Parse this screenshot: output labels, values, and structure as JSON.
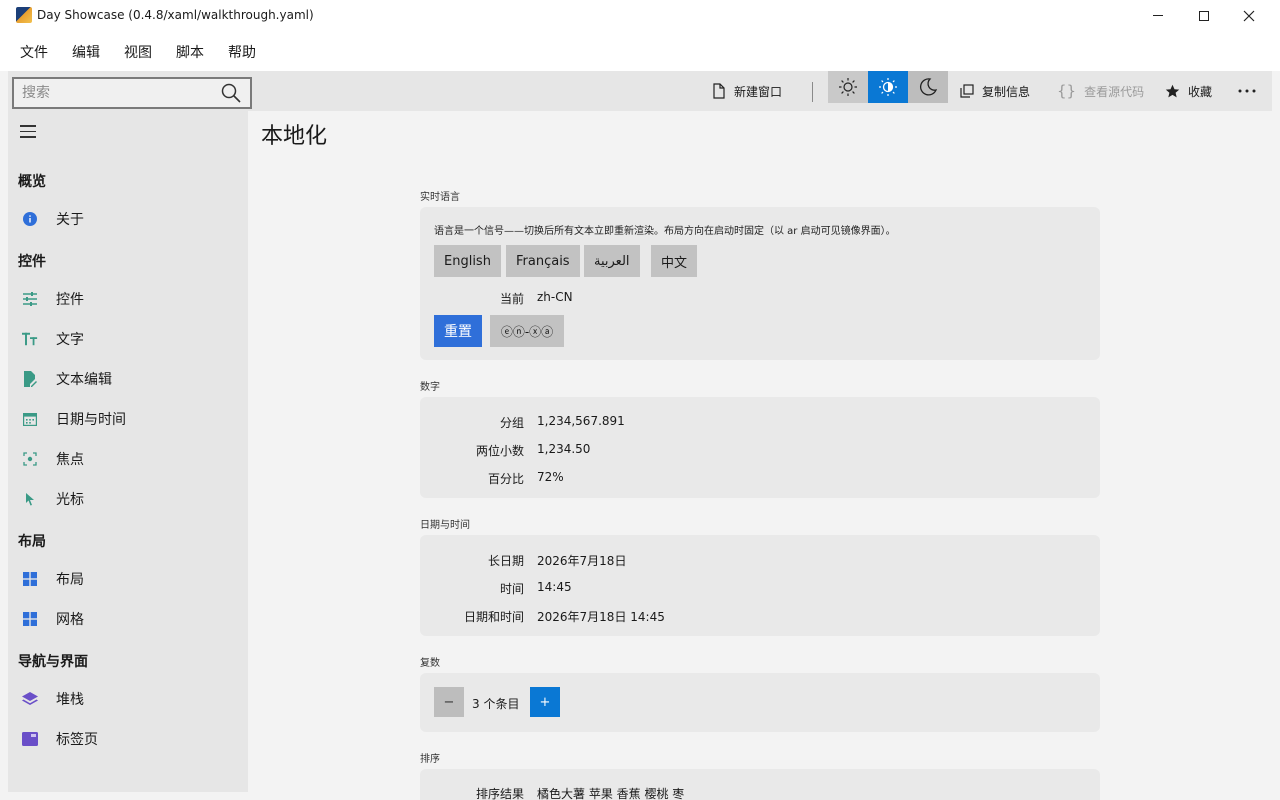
{
  "window": {
    "title": "Day Showcase (0.4.8/xaml/walkthrough.yaml)"
  },
  "menu": [
    "文件",
    "编辑",
    "视图",
    "脚本",
    "帮助"
  ],
  "toolbar": {
    "search_placeholder": "搜索",
    "new_window": "新建窗口",
    "copy_info": "复制信息",
    "view_source": "查看源代码",
    "favorite": "收藏",
    "active_theme": "auto"
  },
  "sidebar": {
    "sections": [
      {
        "title": "概览",
        "items": [
          {
            "label": "关于",
            "icon": "info-icon"
          }
        ]
      },
      {
        "title": "控件",
        "items": [
          {
            "label": "控件",
            "icon": "sliders-icon"
          },
          {
            "label": "文字",
            "icon": "text-size-icon"
          },
          {
            "label": "文本编辑",
            "icon": "edit-document-icon"
          },
          {
            "label": "日期与时间",
            "icon": "calendar-icon"
          },
          {
            "label": "焦点",
            "icon": "focus-icon"
          },
          {
            "label": "光标",
            "icon": "cursor-icon"
          }
        ]
      },
      {
        "title": "布局",
        "items": [
          {
            "label": "布局",
            "icon": "layout-grid-icon"
          },
          {
            "label": "网格",
            "icon": "grid-icon"
          }
        ]
      },
      {
        "title": "导航与界面",
        "items": [
          {
            "label": "堆栈",
            "icon": "stack-icon"
          },
          {
            "label": "标签页",
            "icon": "tabs-icon"
          }
        ]
      }
    ]
  },
  "page": {
    "title": "本地化",
    "live_lang": {
      "label": "实时语言",
      "note": "语言是一个信号——切换后所有文本立即重新渲染。布局方向在启动时固定（以 ar 启动可见镜像界面）。",
      "buttons": [
        "English",
        "Français",
        "العربية",
        "中文"
      ],
      "current_key": "当前",
      "current_value": "zh-CN",
      "reset": "重置",
      "pseudo": "ⓔⓝ-ⓧⓐ"
    },
    "numbers": {
      "label": "数字",
      "rows": [
        {
          "k": "分组",
          "v": "1,234,567.891"
        },
        {
          "k": "两位小数",
          "v": "1,234.50"
        },
        {
          "k": "百分比",
          "v": "72%"
        }
      ]
    },
    "datetime": {
      "label": "日期与时间",
      "rows": [
        {
          "k": "长日期",
          "v": "2026年7月18日"
        },
        {
          "k": "时间",
          "v": "14:45"
        },
        {
          "k": "日期和时间",
          "v": "2026年7月18日 14:45"
        }
      ]
    },
    "plural": {
      "label": "复数",
      "minus": "−",
      "text": "3 个条目",
      "plus": "+"
    },
    "sort": {
      "label": "排序",
      "key": "排序结果",
      "value": "橘色大薯 苹果 香蕉 樱桃 枣"
    }
  },
  "colors": {
    "accent": "#0a78d4",
    "reset_button": "#2f6fd9"
  }
}
